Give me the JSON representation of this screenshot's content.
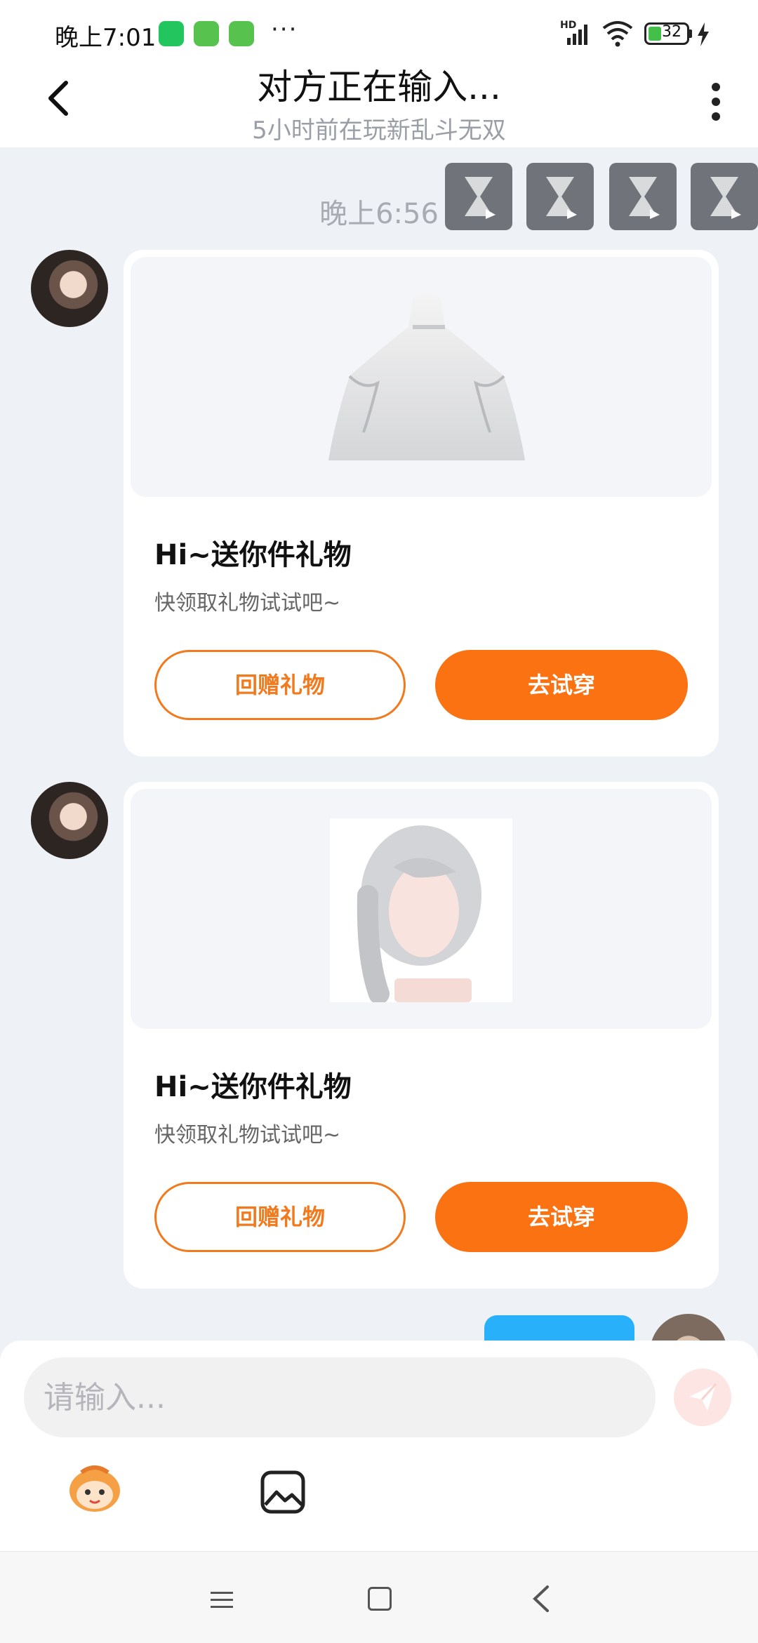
{
  "status_bar": {
    "time": "晚上7:01",
    "dots": "···",
    "network": "HD",
    "battery": "32"
  },
  "header": {
    "title": "对方正在输入...",
    "subtitle": "5小时前在玩新乱斗无双"
  },
  "chat": {
    "timestamp": "晚上6:56",
    "messages": [
      {
        "title": "Hi~送你件礼物",
        "desc": "快领取礼物试试吧~",
        "btn_return": "回赠礼物",
        "btn_try": "去试穿"
      },
      {
        "title": "Hi~送你件礼物",
        "desc": "快领取礼物试试吧~",
        "btn_return": "回赠礼物",
        "btn_try": "去试穿"
      }
    ]
  },
  "input": {
    "placeholder": "请输入..."
  },
  "colors": {
    "accent": "#fb7212",
    "bubble_blue": "#29b0fb"
  }
}
